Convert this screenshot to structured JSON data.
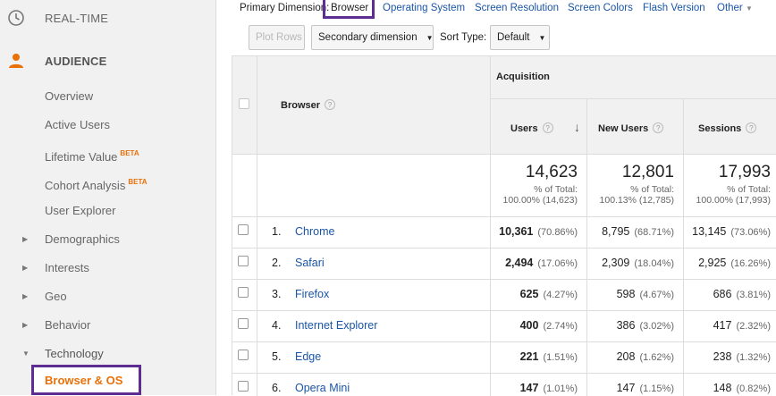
{
  "sidebar": {
    "realtime": "REAL-TIME",
    "audience": "AUDIENCE",
    "items": [
      {
        "label": "Overview",
        "beta": ""
      },
      {
        "label": "Active Users",
        "beta": ""
      },
      {
        "label": "Lifetime Value",
        "beta": "BETA"
      },
      {
        "label": "Cohort Analysis",
        "beta": "BETA"
      },
      {
        "label": "User Explorer",
        "beta": ""
      }
    ],
    "groups": [
      "Demographics",
      "Interests",
      "Geo",
      "Behavior",
      "Technology"
    ],
    "active": "Browser & OS",
    "accent": "#e8710a",
    "highlight": "#5d2d91"
  },
  "dimension_bar": {
    "label": "Primary Dimension:",
    "selected": "Browser",
    "options": [
      "Operating System",
      "Screen Resolution",
      "Screen Colors",
      "Flash Version",
      "Other"
    ]
  },
  "controls": {
    "plot_rows": "Plot Rows",
    "secondary": "Secondary dimension",
    "sort_label": "Sort Type:",
    "sort_value": "Default"
  },
  "table": {
    "group_header": "Acquisition",
    "col_browser": "Browser",
    "col_users": "Users",
    "col_new_users": "New Users",
    "col_sessions": "Sessions",
    "totals": {
      "users": "14,623",
      "users_pct": "% of Total:",
      "users_of": "100.00% (14,623)",
      "new_users": "12,801",
      "new_users_pct": "% of Total:",
      "new_users_of": "100.13% (12,785)",
      "sessions": "17,993",
      "sessions_pct": "% of Total:",
      "sessions_of": "100.00% (17,993)"
    },
    "rows": [
      {
        "num": "1.",
        "name": "Chrome",
        "users": "10,361",
        "users_pct": "(70.86%)",
        "new_users": "8,795",
        "new_users_pct": "(68.71%)",
        "sessions": "13,145",
        "sessions_pct": "(73.06%)"
      },
      {
        "num": "2.",
        "name": "Safari",
        "users": "2,494",
        "users_pct": "(17.06%)",
        "new_users": "2,309",
        "new_users_pct": "(18.04%)",
        "sessions": "2,925",
        "sessions_pct": "(16.26%)"
      },
      {
        "num": "3.",
        "name": "Firefox",
        "users": "625",
        "users_pct": "(4.27%)",
        "new_users": "598",
        "new_users_pct": "(4.67%)",
        "sessions": "686",
        "sessions_pct": "(3.81%)"
      },
      {
        "num": "4.",
        "name": "Internet Explorer",
        "users": "400",
        "users_pct": "(2.74%)",
        "new_users": "386",
        "new_users_pct": "(3.02%)",
        "sessions": "417",
        "sessions_pct": "(2.32%)"
      },
      {
        "num": "5.",
        "name": "Edge",
        "users": "221",
        "users_pct": "(1.51%)",
        "new_users": "208",
        "new_users_pct": "(1.62%)",
        "sessions": "238",
        "sessions_pct": "(1.32%)"
      },
      {
        "num": "6.",
        "name": "Opera Mini",
        "users": "147",
        "users_pct": "(1.01%)",
        "new_users": "147",
        "new_users_pct": "(1.15%)",
        "sessions": "148",
        "sessions_pct": "(0.82%)"
      }
    ]
  }
}
